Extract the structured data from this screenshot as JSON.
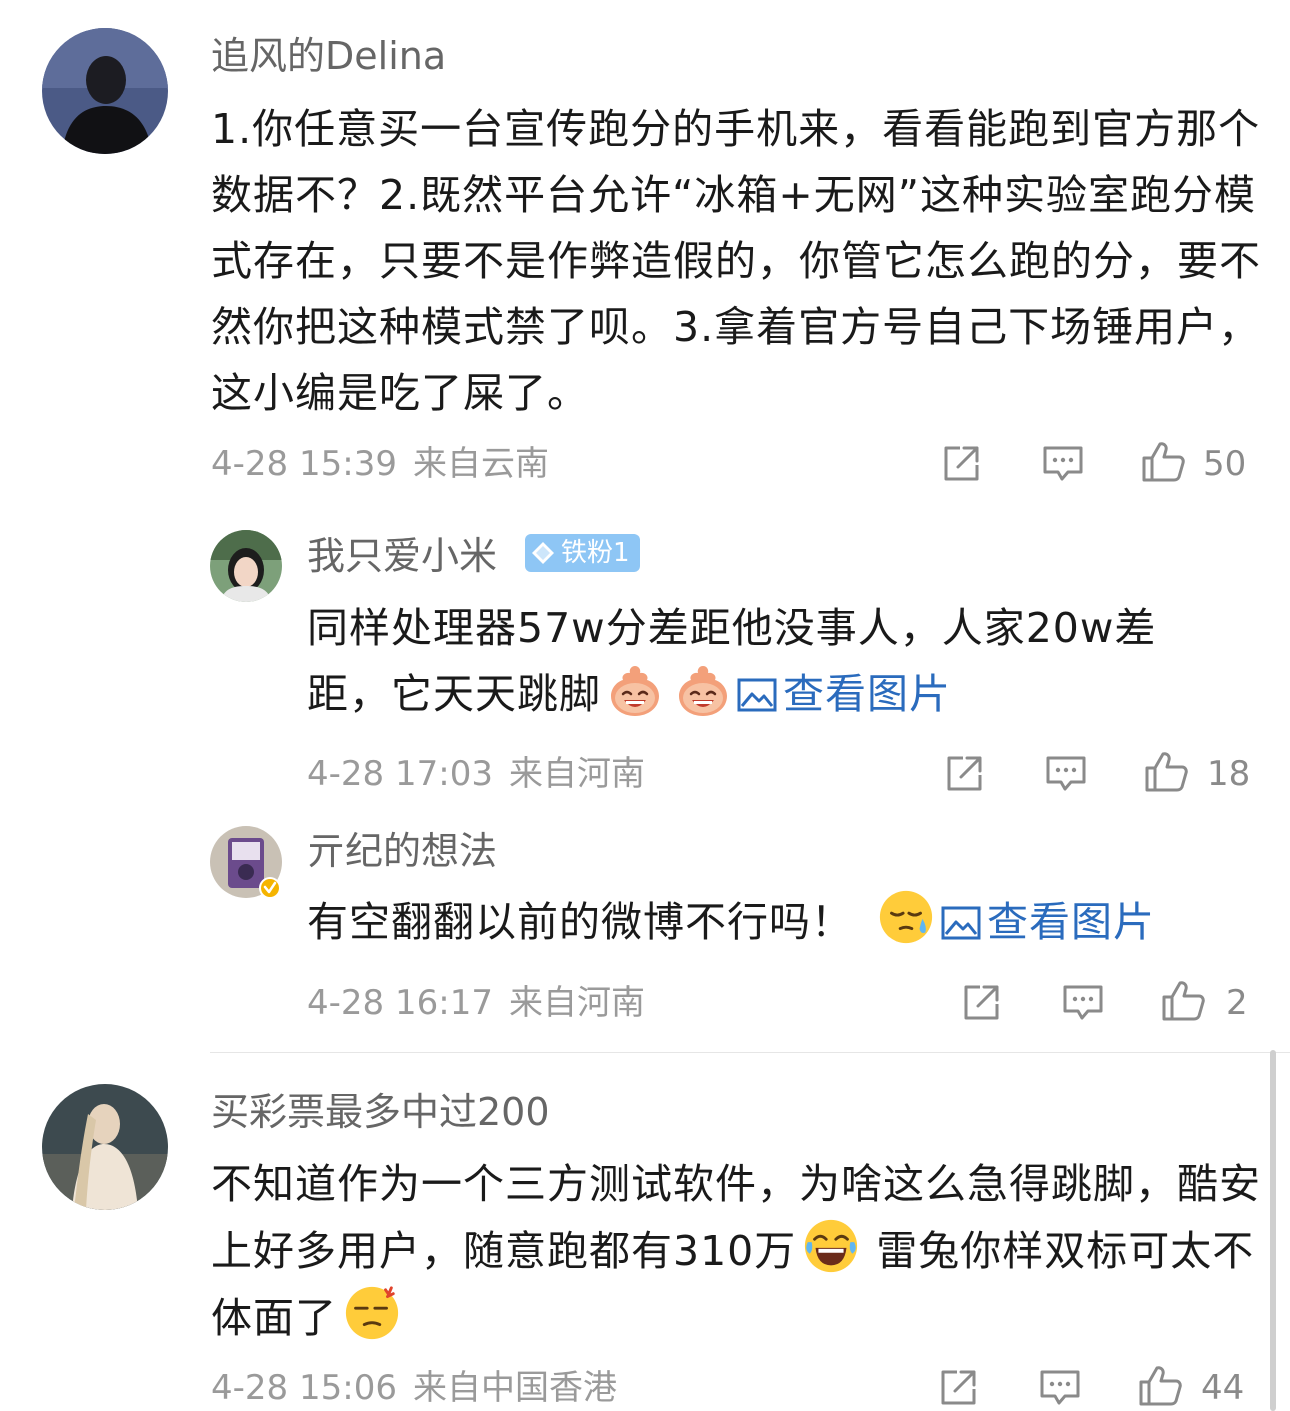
{
  "comments": [
    {
      "username": "追风的Delina",
      "text": "1.你任意买一台宣传跑分的手机来，看看能跑到官方那个数据不？2.既然平台允许“冰箱+无网”这种实验室跑分模式存在，只要不是作弊造假的，你管它怎么跑的分，要不然你把这种模式禁了呗。3.拿着官方号自己下场锤用户，这小编是吃了屎了。",
      "time": "4-28 15:39",
      "location": "来自云南",
      "likes": "50"
    },
    {
      "username": "我只爱小米",
      "badge": "铁粉1",
      "text": "同样处理器57w分差距他没事人，人家20w差距，它天天跳脚",
      "link": "查看图片",
      "time": "4-28 17:03",
      "location": "来自河南",
      "likes": "18"
    },
    {
      "username": "亓纪的想法",
      "text": "有空翻翻以前的微博不行吗！",
      "link": "查看图片",
      "time": "4-28 16:17",
      "location": "来自河南",
      "likes": "2"
    },
    {
      "username": "买彩票最多中过200",
      "text_part1": "不知道作为一个三方测试软件，为啥这么急得跳脚，酷安上好多用户，随意跑都有310万",
      "text_part2": "雷兔你样双标可太不体面了",
      "time": "4-28 15:06",
      "location": "来自中国香港",
      "likes": "44"
    }
  ],
  "icons": {
    "share": "share-icon",
    "comment": "comment-icon",
    "like": "thumbs-up-icon",
    "image": "image-icon",
    "badge": "diamond-icon"
  },
  "colors": {
    "link": "#2a6bbd",
    "badge": "#8ec6f5",
    "meta": "#9a9a9a",
    "username": "#666666"
  }
}
